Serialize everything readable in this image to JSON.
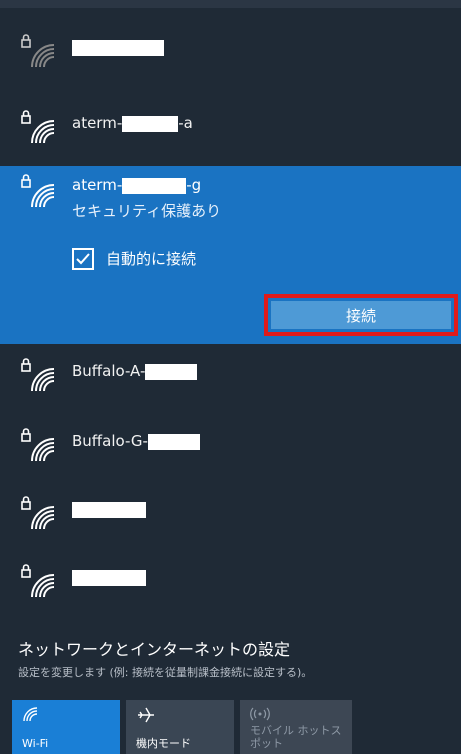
{
  "networks": [
    {
      "name_prefix": "",
      "name_suffix": ""
    },
    {
      "name_prefix": "aterm-",
      "name_suffix": "-a"
    },
    {
      "name_prefix": "aterm-",
      "name_suffix": "-g",
      "status": "セキュリティ保護あり",
      "auto_connect_label": "自動的に接続",
      "auto_connect_checked": true,
      "connect_label": "接続"
    },
    {
      "name_prefix": "Buffalo-A-",
      "name_suffix": ""
    },
    {
      "name_prefix": "Buffalo-G-",
      "name_suffix": ""
    },
    {
      "name_prefix": "",
      "name_suffix": ""
    },
    {
      "name_prefix": "",
      "name_suffix": ""
    }
  ],
  "settings": {
    "title": "ネットワークとインターネットの設定",
    "subtitle": "設定を変更します (例: 接続を従量制課金接続に設定する)。"
  },
  "quick_actions": [
    {
      "label": "Wi-Fi",
      "icon": "wifi-icon",
      "active": true
    },
    {
      "label": "機内モード",
      "icon": "airplane-icon",
      "active": false
    },
    {
      "label": "モバイル ホットスポット",
      "icon": "hotspot-icon",
      "active": false
    }
  ],
  "colors": {
    "background": "#1f2a36",
    "selected": "#1a73c2",
    "connect_button": "#4e9ad6",
    "highlight_border": "#e01b1b",
    "wifi_tile": "#1a7fd6"
  }
}
